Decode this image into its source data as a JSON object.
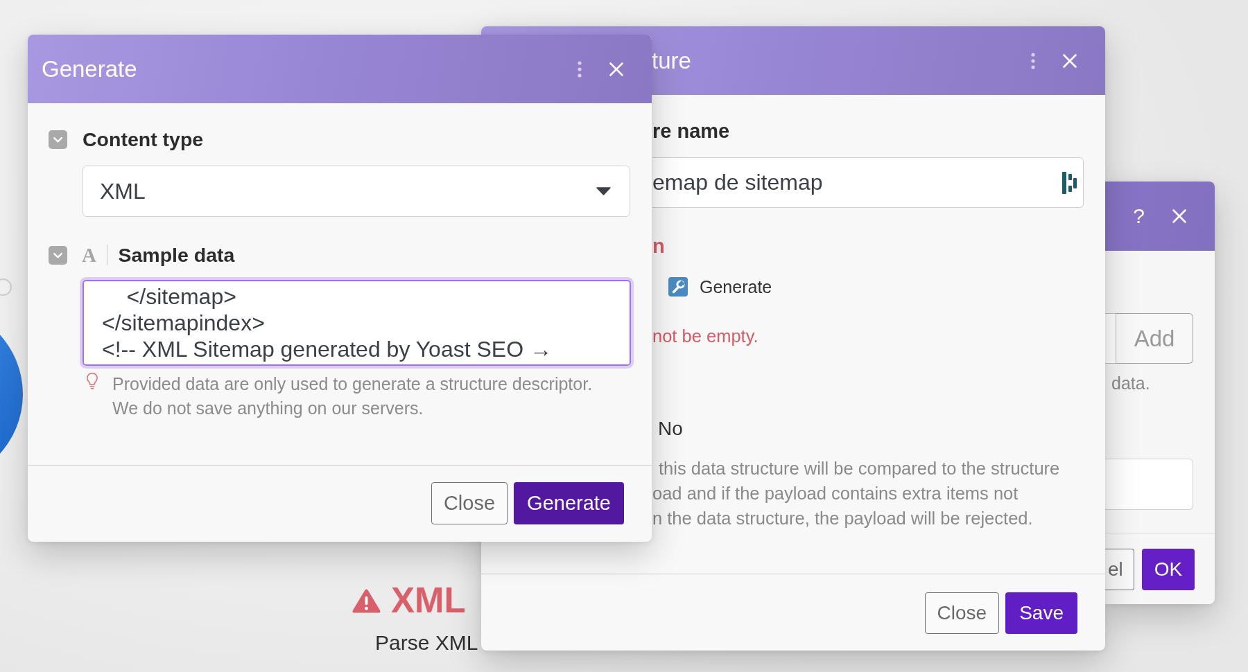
{
  "canvas": {
    "module": {
      "warning": true,
      "badge": "XML",
      "name": "Parse XML"
    }
  },
  "generate_dialog": {
    "title": "Generate",
    "fields": [
      {
        "kind": "select",
        "label": "Content type",
        "value": "XML"
      },
      {
        "kind": "textarea",
        "type_glyph": "A",
        "label": "Sample data",
        "focused": true,
        "value": "    </sitemap>\n</sitemapindex>\n<!-- XML Sitemap generated by Yoast SEO →",
        "hint": "Provided data are only used to generate a structure descriptor. We do not save anything on our servers."
      }
    ],
    "buttons": [
      {
        "label": "Close",
        "kind": "secondary"
      },
      {
        "label": "Generate",
        "kind": "primary"
      }
    ]
  },
  "structure_dialog": {
    "title": "ture",
    "name_label": "re name",
    "name_value": "emap de sitemap",
    "section_label": "n",
    "action_button": "Generate",
    "error": "not be empty.",
    "option": "No",
    "help": "this data structure will be compared to the structure\noad and if the payload contains extra items not\nn the data structure, the payload will be rejected.",
    "buttons": [
      {
        "label": "Close",
        "kind": "secondary"
      },
      {
        "label": "Save",
        "kind": "primary"
      }
    ]
  },
  "item_dialog": {
    "help_button": "?",
    "add_button": "Add",
    "hint": "data.",
    "buttons": [
      {
        "label": "el",
        "kind": "secondary"
      },
      {
        "label": "OK",
        "kind": "primary"
      }
    ]
  }
}
